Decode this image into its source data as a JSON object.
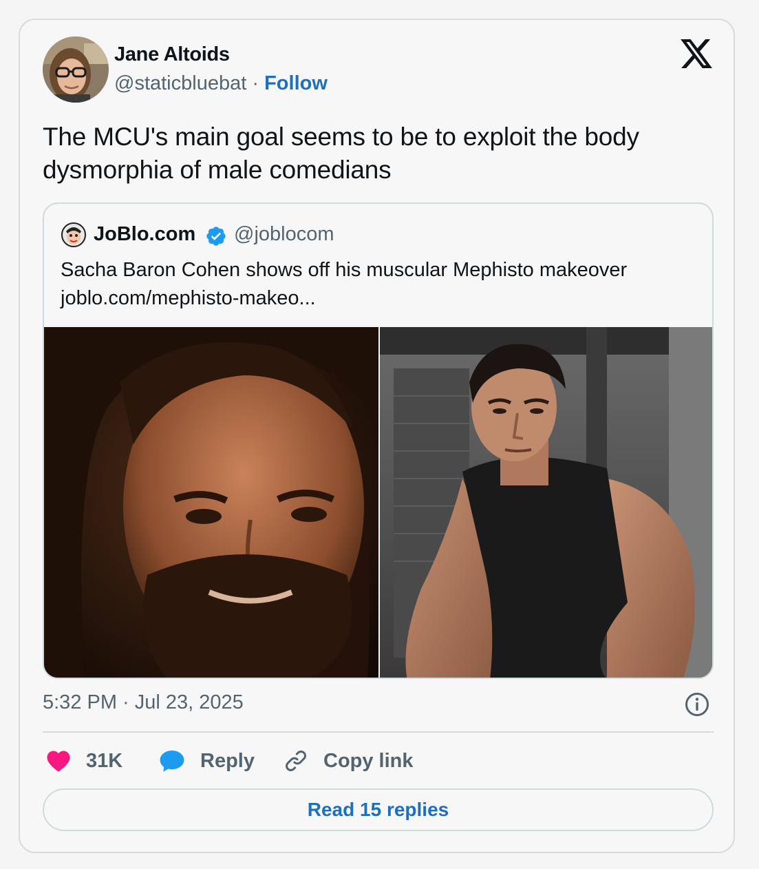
{
  "author": {
    "name": "Jane Altoids",
    "handle": "@staticbluebat",
    "separator": "·",
    "follow_label": "Follow"
  },
  "tweet": {
    "text": "The MCU's main goal seems to be to exploit the body dysmorphia of male comedians",
    "timestamp": "5:32 PM · Jul 23, 2025"
  },
  "quoted": {
    "name": "JoBlo.com",
    "handle": "@joblocom",
    "text_line1": "Sacha Baron Cohen shows off his muscular Mephisto makeover",
    "text_line2": "joblo.com/mephisto-makeo..."
  },
  "actions": {
    "like_count": "31K",
    "reply_label": "Reply",
    "copy_link_label": "Copy link"
  },
  "read_replies_label": "Read 15 replies",
  "icons": {
    "logo": "x-logo-icon",
    "verified": "verified-badge-icon",
    "info": "info-icon",
    "like": "heart-icon",
    "reply": "speech-bubble-icon",
    "copy": "link-icon"
  },
  "colors": {
    "like": "#f91880",
    "reply": "#1d9bf0",
    "link": "#1d6fc0",
    "verified": "#1d9bf0"
  }
}
